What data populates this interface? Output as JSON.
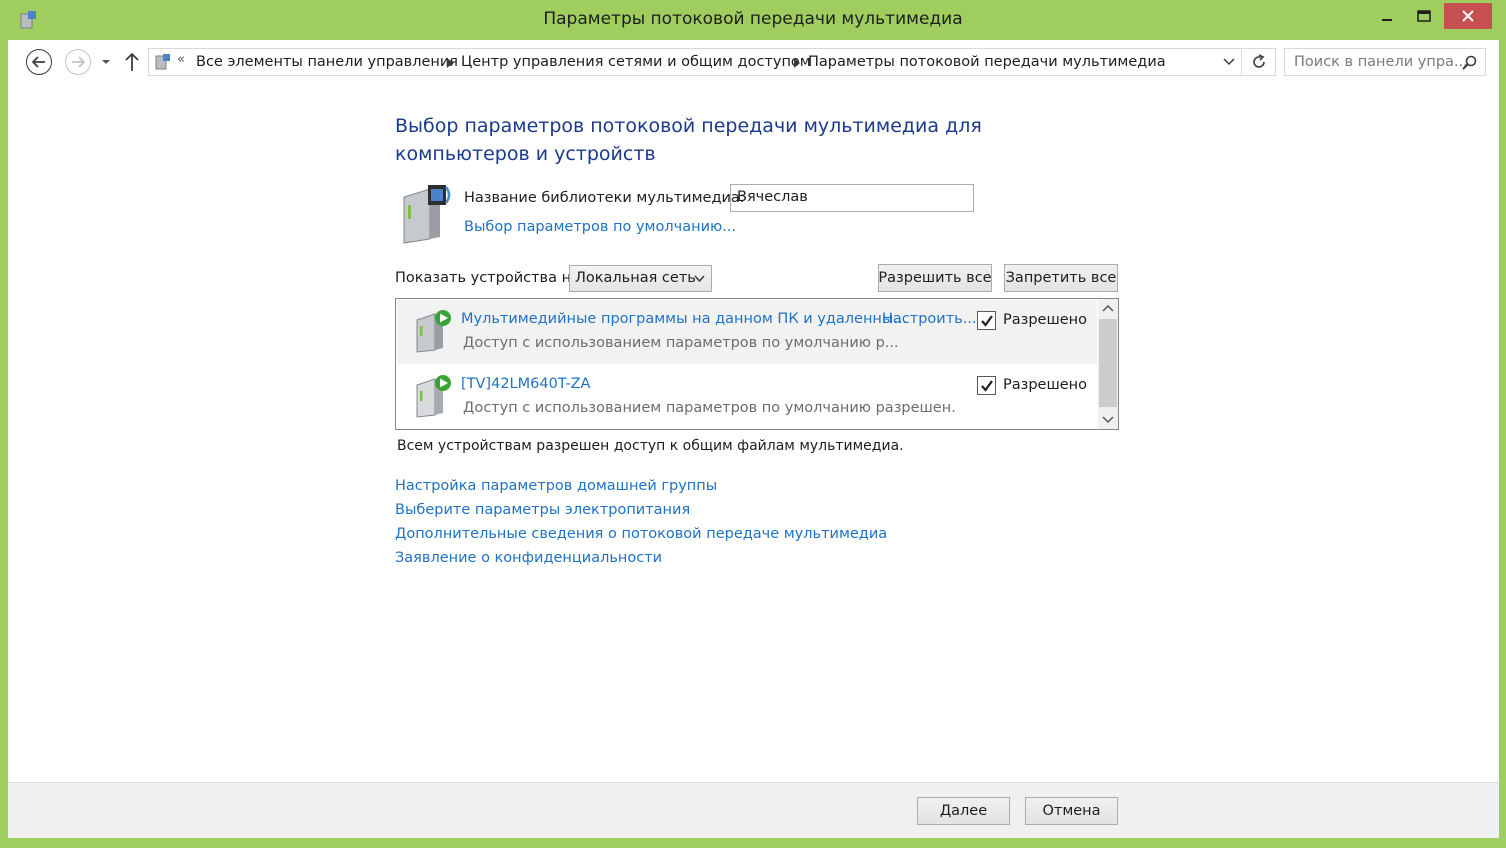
{
  "window": {
    "title": "Параметры потоковой передачи мультимедиа"
  },
  "addressbar": {
    "overflow": "«",
    "crumbs": [
      "Все элементы панели управления",
      "Центр управления сетями и общим доступом",
      "Параметры потоковой передачи мультимедиа"
    ],
    "search_placeholder": "Поиск в панели упра..."
  },
  "main": {
    "heading": "Выбор параметров потоковой передачи мультимедиа для компьютеров и устройств",
    "library_label": "Название библиотеки мультимедиа:",
    "library_value": "Вячеслав",
    "defaults_link": "Выбор параметров по умолчанию...",
    "show_devices_label": "Показать устройства на:",
    "network_selected": "Локальная сеть",
    "allow_all": "Разрешить все",
    "deny_all": "Запретить все",
    "devices": [
      {
        "name": "Мультимедийные программы на данном ПК и удаленны...",
        "configure": "Настроить...",
        "description": "Доступ с использованием параметров по умолчанию р...",
        "checked": true,
        "state": "Разрешено"
      },
      {
        "name": "[TV]42LM640T-ZA",
        "description": "Доступ с использованием параметров по умолчанию разрешен.",
        "checked": true,
        "state": "Разрешено"
      }
    ],
    "status": "Всем устройствам разрешен доступ к общим файлам мультимедиа.",
    "links": [
      "Настройка параметров домашней группы",
      "Выберите параметры электропитания",
      "Дополнительные сведения о потоковой передаче мультимедиа",
      "Заявление о конфиденциальности"
    ]
  },
  "footer": {
    "next": "Далее",
    "cancel": "Отмена"
  },
  "colors": {
    "frame": "#9fcd5e",
    "close": "#c75050",
    "link": "#1f72c4",
    "heading": "#1b3a8c"
  }
}
